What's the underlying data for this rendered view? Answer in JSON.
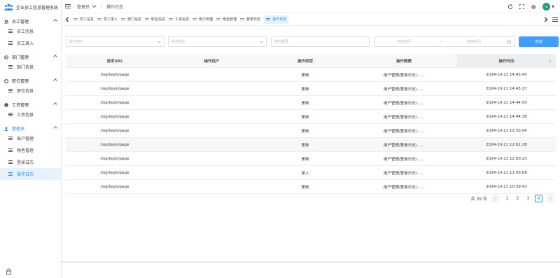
{
  "app": {
    "title": "企业员工信息管理系统"
  },
  "sidebar": {
    "groups": [
      {
        "label": "员工管理",
        "icon": "users-icon",
        "items": [
          {
            "label": "员工信息"
          },
          {
            "label": "员工录入"
          }
        ]
      },
      {
        "label": "部门管理",
        "icon": "target-icon",
        "items": [
          {
            "label": "部门信息"
          }
        ]
      },
      {
        "label": "职位管理",
        "icon": "circle-icon",
        "items": [
          {
            "label": "职位信息"
          }
        ]
      },
      {
        "label": "工资管理",
        "icon": "money-icon",
        "items": [
          {
            "label": "工资信息"
          }
        ]
      },
      {
        "label": "管理员",
        "icon": "user-icon",
        "items": [
          {
            "label": "账户管理"
          },
          {
            "label": "角色管理"
          },
          {
            "label": "登录日志"
          },
          {
            "label": "操作日志",
            "active": true
          }
        ]
      }
    ]
  },
  "header": {
    "breadcrumb": [
      "管理员",
      "操作日志"
    ],
    "separator": "/",
    "avatar_letter": "a",
    "accent_color": "#2d8cf0"
  },
  "tabs": [
    "员工信息",
    "员工录入",
    "部门信息",
    "职位信息",
    "工资信息",
    "账户管理",
    "角色管理",
    "登录日志",
    "操作日志"
  ],
  "filters": {
    "user_placeholder": "操作用户",
    "type_placeholder": "操作类型",
    "summary_placeholder": "操作概要",
    "start_placeholder": "开始时间",
    "range_sep": "→",
    "end_placeholder": "结束时间",
    "query_label": "查询"
  },
  "table": {
    "columns": [
      "请求URL",
      "操作用户",
      "操作类型",
      "操作概要",
      "操作时间"
    ],
    "rows": [
      {
        "url": "/log/login/page",
        "user": "",
        "type": "更新",
        "summary": "用户管理/登录日志/......",
        "time": "2024-10-21 14:45:45"
      },
      {
        "url": "/log/login/page",
        "user": "",
        "type": "更新",
        "summary": "用户管理/登录日志/......",
        "time": "2024-10-21 14:45:27"
      },
      {
        "url": "/log/login/page",
        "user": "",
        "type": "更新",
        "summary": "用户管理/登录日志/......",
        "time": "2024-10-21 14:44:50"
      },
      {
        "url": "/log/login/page",
        "user": "",
        "type": "更新",
        "summary": "用户管理/登录日志/......",
        "time": "2024-10-21 14:44:36"
      },
      {
        "url": "/log/login/page",
        "user": "",
        "type": "更新",
        "summary": "用户管理/登录日志/......",
        "time": "2024-10-21 12:33:04"
      },
      {
        "url": "/log/login/page",
        "user": "",
        "type": "更新",
        "summary": "用户管理/登录日志/......",
        "time": "2024-10-21 12:01:28",
        "highlight": true
      },
      {
        "url": "/log/login/page",
        "user": "",
        "type": "更新",
        "summary": "用户管理/登录日志/......",
        "time": "2024-10-21 12:00:23"
      },
      {
        "url": "/log/login/page",
        "user": "",
        "type": "录入",
        "summary": "用户管理/登录日志/......",
        "time": "2024-10-21 11:56:08"
      },
      {
        "url": "/log/login/page",
        "user": "",
        "type": "更新",
        "summary": "用户管理/登录日志/......",
        "time": "2024-10-21 10:39:43"
      }
    ]
  },
  "pagination": {
    "total_text": "共 39 条",
    "pages": [
      "1",
      "2",
      "3",
      "4"
    ],
    "current": "4",
    "prev": "‹",
    "next": "›"
  }
}
